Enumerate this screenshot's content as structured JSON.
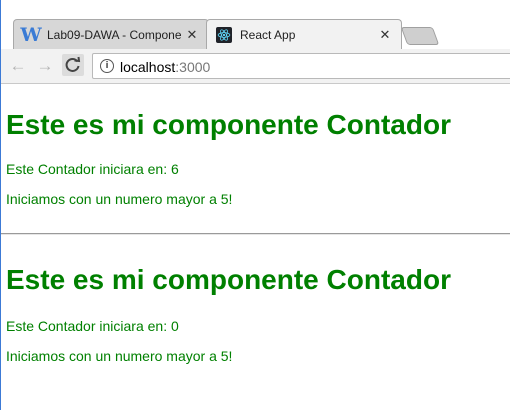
{
  "browser": {
    "tabs": [
      {
        "title": "Lab09-DAWA - Compone",
        "icon": "w-icon",
        "close": "✕"
      },
      {
        "title": "React App",
        "icon": "react-icon",
        "close": "✕"
      }
    ],
    "nav": {
      "back": "←",
      "forward": "→",
      "reload": "C"
    },
    "address": {
      "info": "i",
      "host": "localhost",
      "port": ":3000"
    }
  },
  "page": {
    "sections": [
      {
        "heading": "Este es mi componente Contador",
        "start_text": "Este Contador iniciara en: 6",
        "message": "Iniciamos con un numero mayor a 5!"
      },
      {
        "heading": "Este es mi componente Contador",
        "start_text": "Este Contador iniciara en: 0",
        "message": "Iniciamos con un numero mayor a 5!"
      }
    ]
  },
  "colors": {
    "text_green": "#008000",
    "accent_blue": "#3c7ad6"
  }
}
